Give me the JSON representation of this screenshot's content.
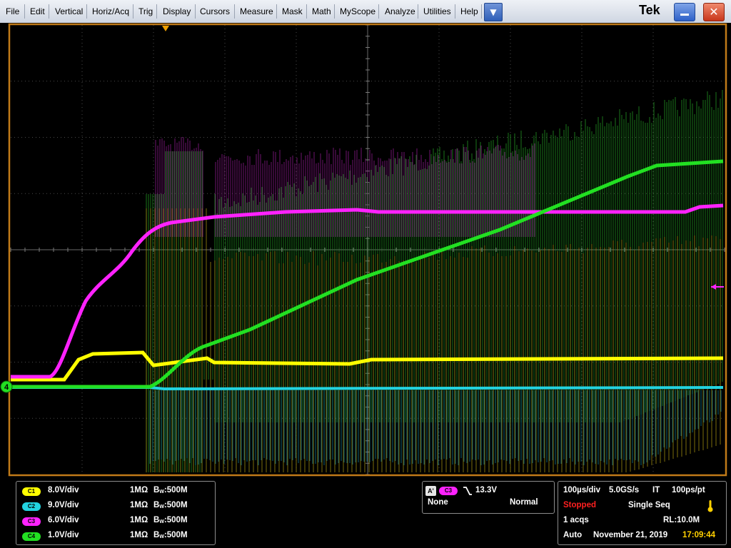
{
  "menu": {
    "items": [
      "File",
      "Edit",
      "Vertical",
      "Horiz/Acq",
      "Trig",
      "Display",
      "Cursors",
      "Measure",
      "Mask",
      "Math",
      "MyScope",
      "Analyze",
      "Utilities",
      "Help"
    ],
    "dropdown_icon": "chevron-down-icon",
    "brand": "Tek"
  },
  "colors": {
    "c1": "#ffff00",
    "c2": "#22d3e0",
    "c3": "#ff22ff",
    "c4": "#22e022",
    "trigger_marker": "#f0a000",
    "graticule": "#5a5a5a",
    "frame": "#c07a18"
  },
  "scope": {
    "ground_marker_label": "4"
  },
  "channels": [
    {
      "id": "C1",
      "scale": "8.0V/div",
      "impedance": "1MΩ",
      "bw_prefix": "B",
      "bw_sub": "W",
      "bw_value": ":500M"
    },
    {
      "id": "C2",
      "scale": "9.0V/div",
      "impedance": "1MΩ",
      "bw_prefix": "B",
      "bw_sub": "W",
      "bw_value": ":500M"
    },
    {
      "id": "C3",
      "scale": "6.0V/div",
      "impedance": "1MΩ",
      "bw_prefix": "B",
      "bw_sub": "W",
      "bw_value": ":500M"
    },
    {
      "id": "C4",
      "scale": "1.0V/div",
      "impedance": "1MΩ",
      "bw_prefix": "B",
      "bw_sub": "W",
      "bw_value": ":500M"
    }
  ],
  "trigger": {
    "type_label": "A'",
    "source": "C3",
    "slope_icon": "falling-edge-icon",
    "level": "13.3V",
    "coupling": "None",
    "mode": "Normal"
  },
  "acquisition": {
    "timebase": "100µs/div",
    "sample_rate": "5.0GS/s",
    "it_label": "IT",
    "resolution": "100ps/pt",
    "state": "Stopped",
    "seq_mode": "Single Seq",
    "acqs": "1 acqs",
    "record_length": "RL:10.0M",
    "trigger_mode": "Auto",
    "date": "November 21, 2019",
    "time": "17:09:44",
    "state_color": "#ff2020",
    "time_color": "#ffd000"
  }
}
